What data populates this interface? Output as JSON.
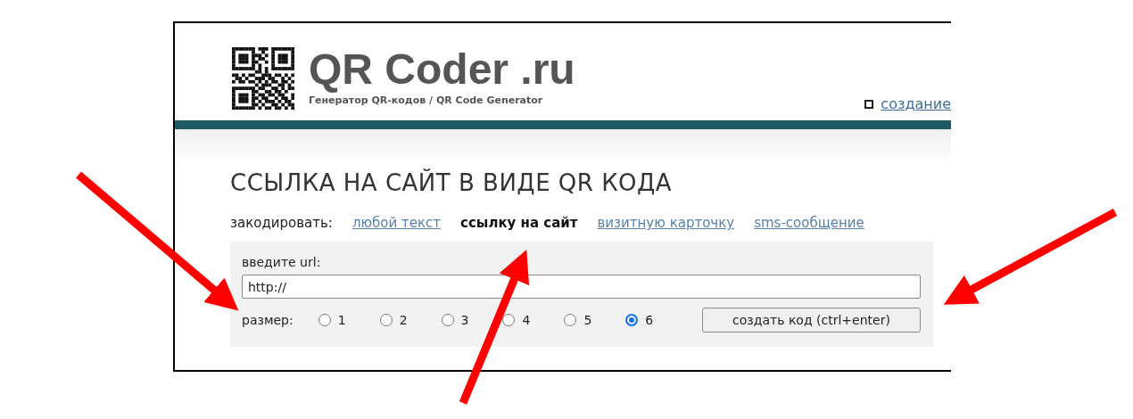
{
  "header": {
    "logo": "QR Coder .ru",
    "tagline": "Генератор QR-кодов / QR Code Generator",
    "nav_link": "создание"
  },
  "page": {
    "heading": "ССЫЛКА НА САЙТ В ВИДЕ QR КОДА",
    "encode_label": "закодировать:",
    "tabs": [
      {
        "label": "любой текст",
        "selected": false
      },
      {
        "label": "ссылку на сайт",
        "selected": true
      },
      {
        "label": "визитную карточку",
        "selected": false
      },
      {
        "label": "sms-сообщение",
        "selected": false
      }
    ]
  },
  "form": {
    "url_label": "введите url:",
    "url_value": "http://",
    "size_label": "размер:",
    "sizes": [
      {
        "label": "1",
        "selected": false
      },
      {
        "label": "2",
        "selected": false
      },
      {
        "label": "3",
        "selected": false
      },
      {
        "label": "4",
        "selected": false
      },
      {
        "label": "5",
        "selected": false
      },
      {
        "label": "6",
        "selected": true
      }
    ],
    "submit": "создать код (ctrl+enter)"
  }
}
